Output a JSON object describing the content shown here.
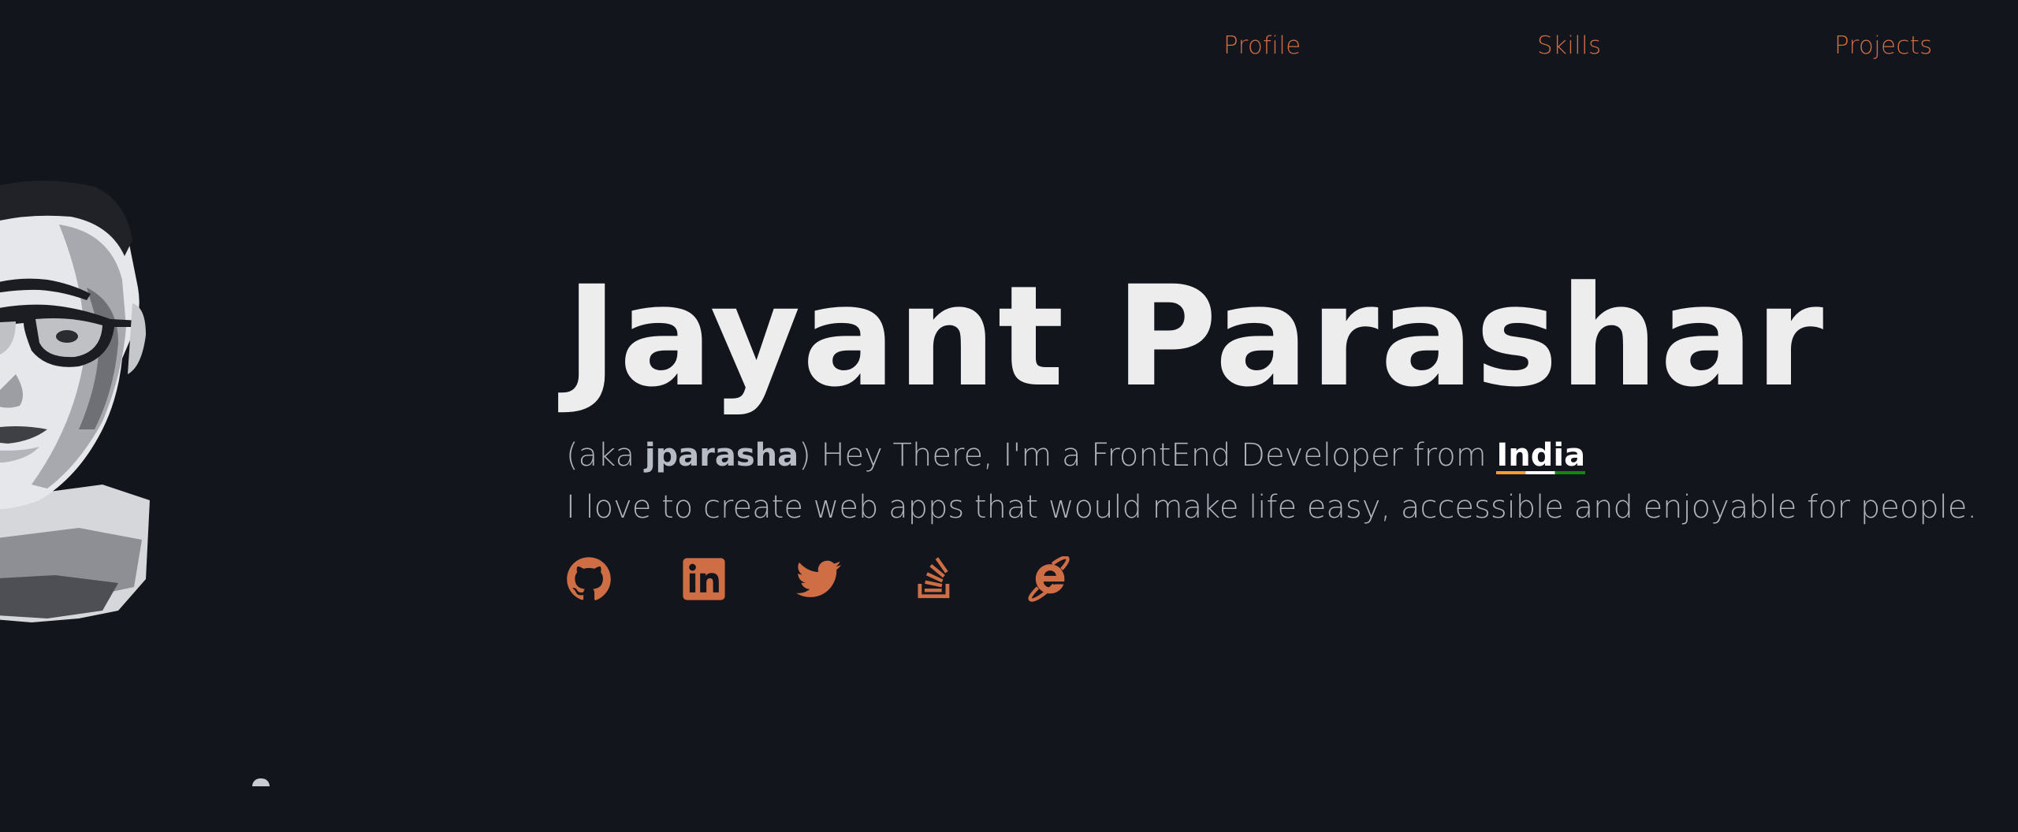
{
  "nav": {
    "profile": "Profile",
    "skills": "Skills",
    "projects": "Projects"
  },
  "hero": {
    "name": "Jayant Parashar",
    "aka_prefix": "(aka ",
    "alias": "jparasha",
    "aka_suffix": ") Hey There, I'm a FrontEnd Developer from ",
    "country": "India",
    "tagline": "I love to create web apps that would make life easy, accessible and enjoyable for people."
  },
  "social": {
    "icons": [
      "github-icon",
      "linkedin-icon",
      "twitter-icon",
      "stackoverflow-icon",
      "internet-explorer-icon"
    ]
  },
  "colors": {
    "background": "#13151d",
    "accent": "#cf6d45",
    "heading": "#ededed",
    "body_text": "#aeb2bb"
  }
}
